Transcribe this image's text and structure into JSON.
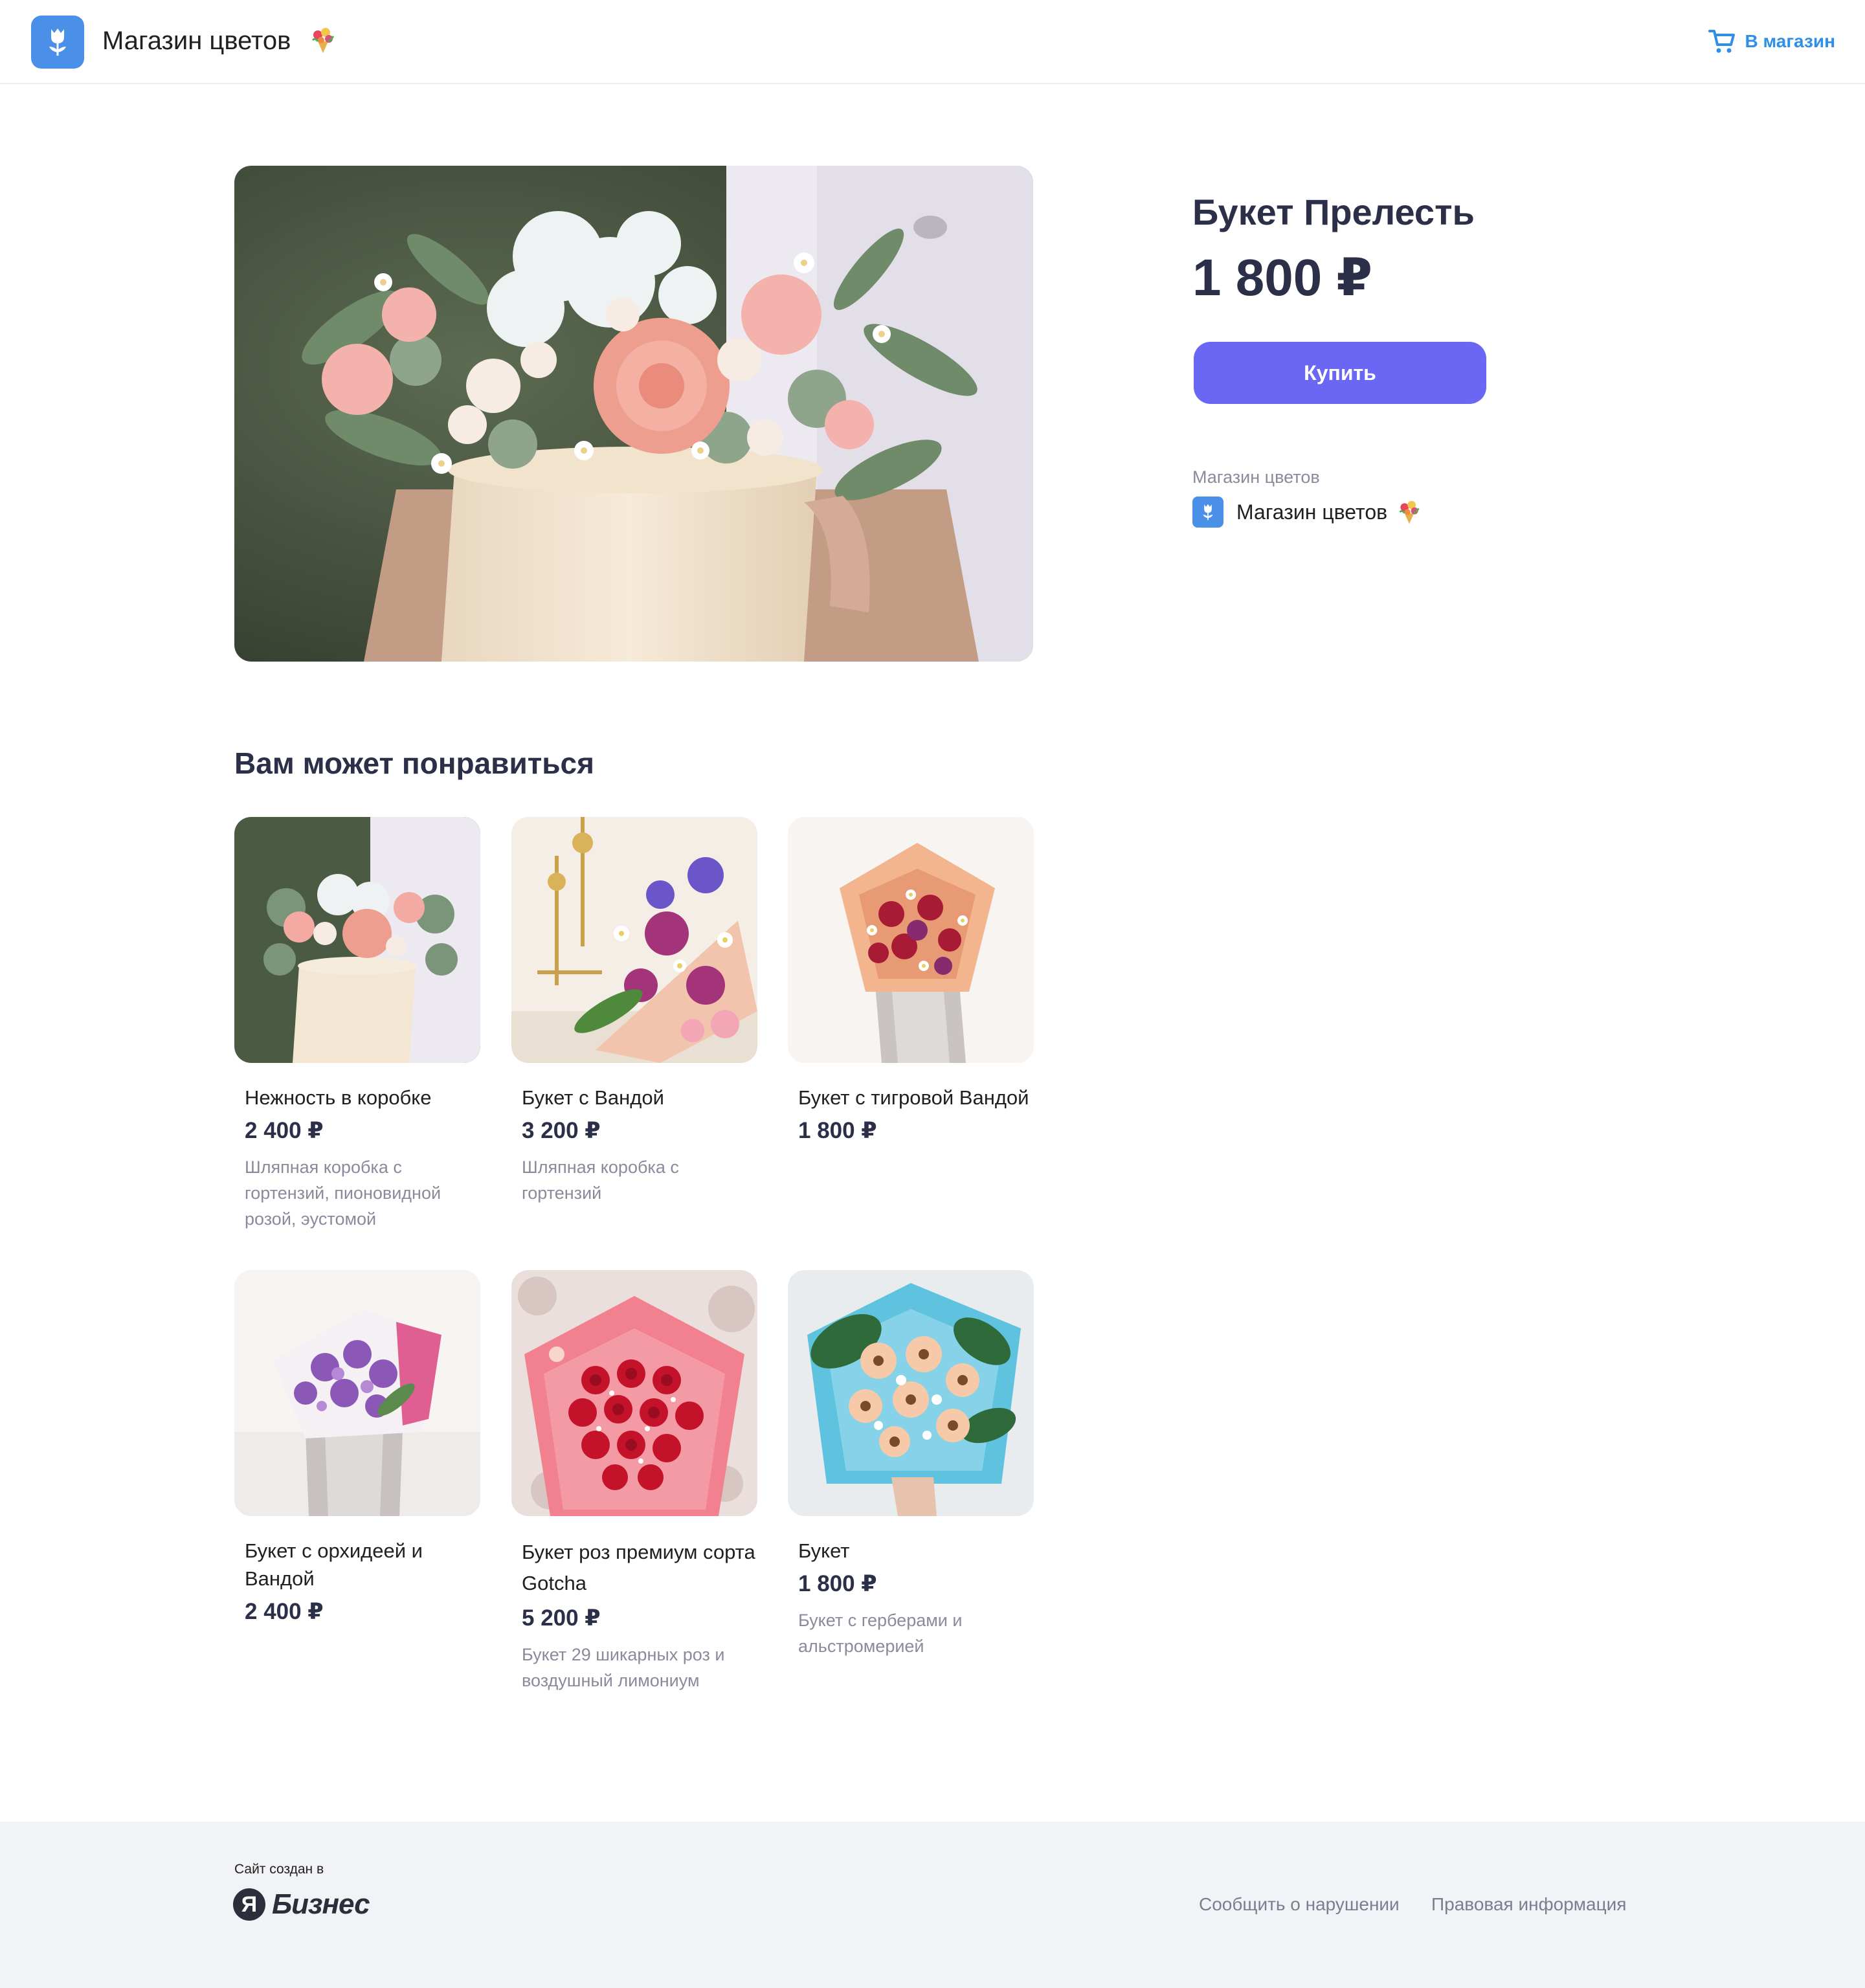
{
  "header": {
    "shop_title": "Магазин цветов",
    "to_shop_label": "В магазин",
    "logo_icon": "tulip-icon",
    "emoji_icon": "bouquet-emoji-icon",
    "cart_icon": "cart-icon"
  },
  "product": {
    "title": "Букет Прелесть",
    "price": "1 800 ₽",
    "buy_label": "Купить",
    "seller_caption": "Магазин цветов",
    "seller_name": "Магазин цветов"
  },
  "recommendations": {
    "title": "Вам может понравиться",
    "items": [
      {
        "name": "Нежность в коробке",
        "price": "2 400 ₽",
        "description": "Шляпная коробка с гортензий, пионовидной розой, эустомой"
      },
      {
        "name": "Букет с Вандой",
        "price": "3 200 ₽",
        "description": "Шляпная коробка с гортензий"
      },
      {
        "name": "Букет с тигровой Вандой",
        "price": "1 800 ₽",
        "description": ""
      },
      {
        "name": "Букет с орхидеей и Вандой",
        "price": "2 400 ₽",
        "description": ""
      },
      {
        "name": "Букет роз премиум сорта Gotcha",
        "price": "5 200 ₽",
        "description": "Букет 29 шикарных роз и воздушный лимониум"
      },
      {
        "name": "Букет",
        "price": "1 800 ₽",
        "description": "Букет с герберами и альстромерией"
      }
    ]
  },
  "footer": {
    "made_in": "Сайт создан в",
    "brand_letter": "Я",
    "brand_word": "Бизнес",
    "report_link": "Сообщить о нарушении",
    "legal_link": "Правовая информация"
  },
  "colors": {
    "accent": "#6a67f4",
    "link": "#2f8fe8",
    "logo_bg": "#4a90e8",
    "heading": "#2c2f48",
    "muted": "#8a8a9c",
    "footer_bg": "#f2f3f6"
  }
}
